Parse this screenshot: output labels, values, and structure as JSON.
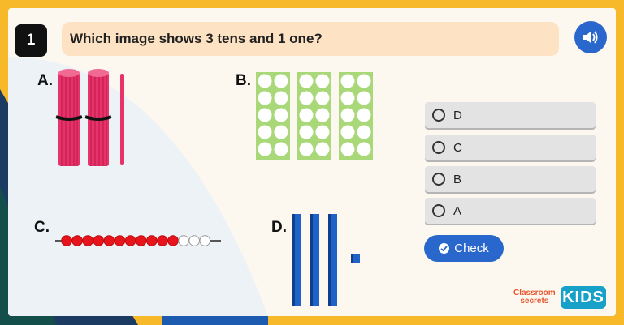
{
  "question": {
    "number": "1",
    "text": "Which image shows 3 tens and 1 one?"
  },
  "options": [
    {
      "label": "A.",
      "depiction": "straw bundles"
    },
    {
      "label": "B.",
      "depiction": "tens frames"
    },
    {
      "label": "C.",
      "depiction": "bead string"
    },
    {
      "label": "D.",
      "depiction": "base ten blocks"
    }
  ],
  "answers": [
    "D",
    "C",
    "B",
    "A"
  ],
  "check_label": "Check",
  "brand": {
    "line1": "Classroom",
    "line2": "secrets",
    "kids": "KIDS"
  },
  "icons": {
    "audio": "speaker-icon",
    "check": "check-circle-icon",
    "radio": "radio-empty-icon"
  },
  "colors": {
    "accent_blue": "#2a67cc",
    "question_bg": "#fde2c3",
    "straw_pink": "#e8336a",
    "frame_green": "#a8d878",
    "bead_red": "#e8141b",
    "block_blue": "#1f63c8",
    "background_yellow": "#f7b829"
  }
}
